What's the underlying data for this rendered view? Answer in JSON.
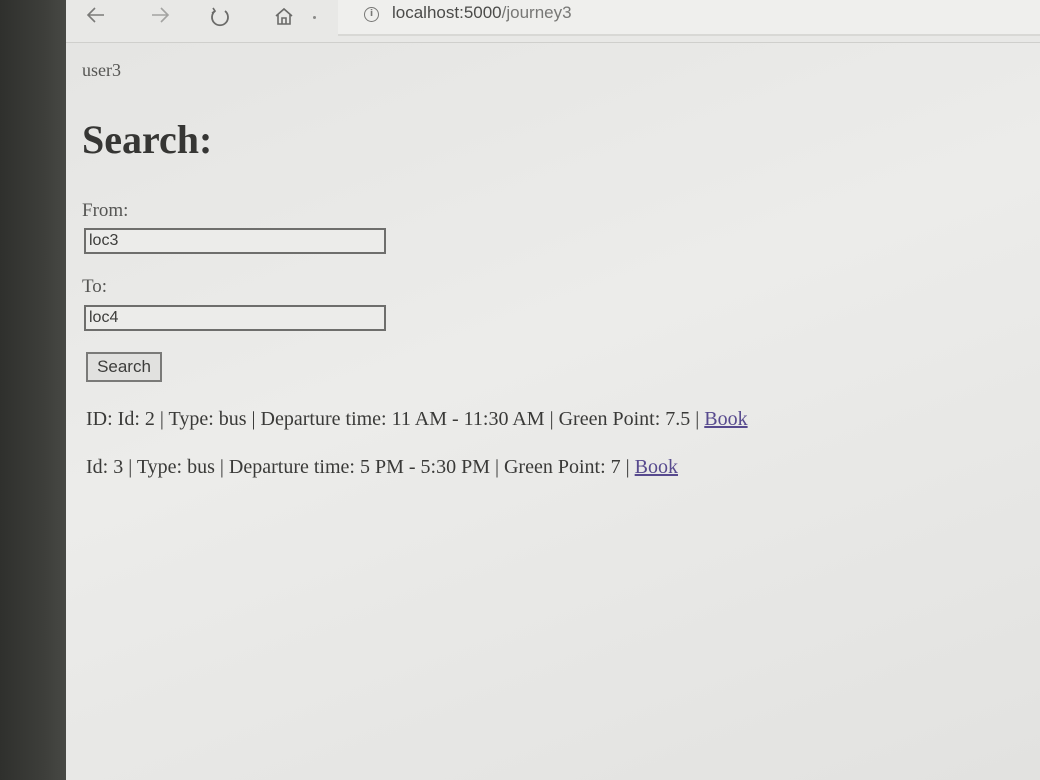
{
  "browser": {
    "back_icon": "arrow-left-icon",
    "forward_icon": "arrow-right-icon",
    "reload_icon": "reload-icon",
    "home_icon": "home-icon",
    "url_host": "localhost:5000",
    "url_path": "/journey3"
  },
  "page": {
    "user": "user3",
    "title": "Search:",
    "from_label": "From:",
    "from_value": "loc3",
    "to_label": "To:",
    "to_value": "loc4",
    "search_button": "Search"
  },
  "results": [
    {
      "text": "ID: Id: 2 | Type: bus | Departure time: 11 AM - 11:30 AM | Green Point: 7.5 |",
      "link": "Book"
    },
    {
      "text": "Id: 3 | Type: bus | Departure time: 5 PM - 5:30 PM | Green Point: 7 |",
      "link": "Book"
    }
  ],
  "colors": {
    "link": "#574a8e",
    "background": "#e8e8e6"
  }
}
